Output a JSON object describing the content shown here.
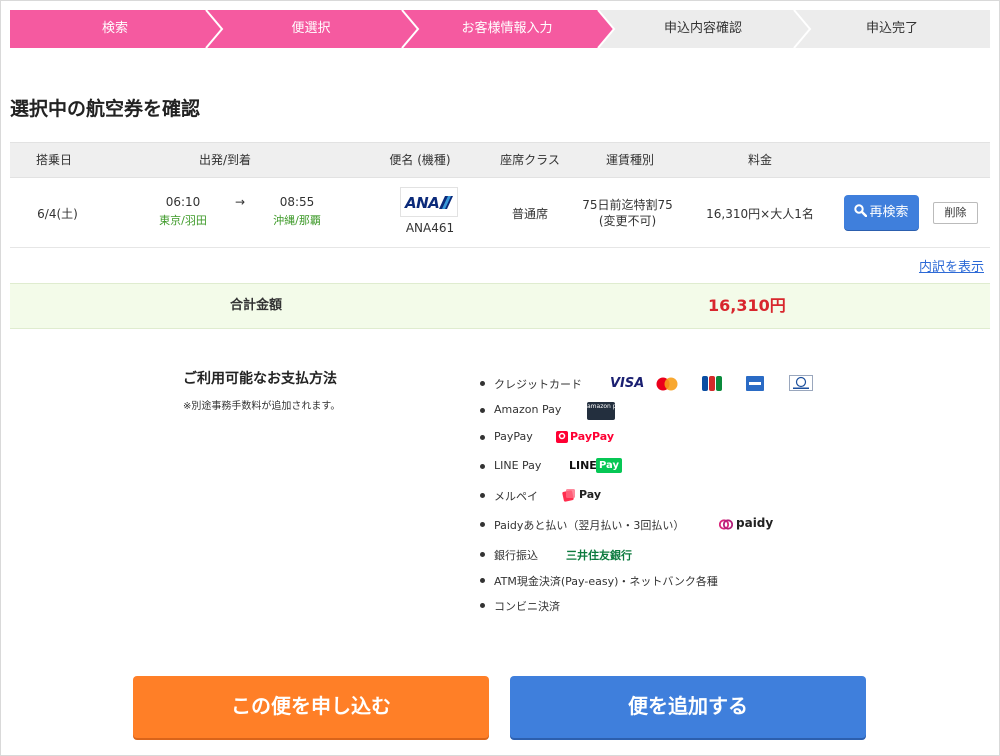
{
  "steps": [
    {
      "label": "検索",
      "active": true
    },
    {
      "label": "便選択",
      "active": true
    },
    {
      "label": "お客様情報入力",
      "active": true
    },
    {
      "label": "申込内容確認",
      "active": false
    },
    {
      "label": "申込完了",
      "active": false
    }
  ],
  "colors": {
    "step_active": "#f55aa0",
    "step_inactive": "#ececec",
    "accent_blue": "#3f7fdc",
    "accent_orange": "#ff7f27",
    "price_red": "#d8262d",
    "green": "#3e9a29"
  },
  "section_title": "選択中の航空券を確認",
  "table": {
    "headers": {
      "date": "搭乗日",
      "route": "出発/到着",
      "flight": "便名 (機種)",
      "seat": "座席クラス",
      "fare": "運賃種別",
      "price": "料金"
    },
    "row": {
      "date": "6/4(土)",
      "dep_time": "06:10",
      "dep_place": "東京/羽田",
      "arrow": "→",
      "arr_time": "08:55",
      "arr_place": "沖縄/那覇",
      "airline_logo": "ANA",
      "flight_no": "ANA461",
      "seat_class": "普通席",
      "fare_line1": "75日前迄特割75",
      "fare_line2": "(変更不可)",
      "price": "16,310円×大人1名",
      "research_label": "再検索",
      "research_icon": "search-icon",
      "delete_label": "削除"
    }
  },
  "detail_link": "内訳を表示",
  "total": {
    "label": "合計金額",
    "amount": "16,310円"
  },
  "payment": {
    "title": "ご利用可能なお支払方法",
    "note": "※別途事務手数料が追加されます。",
    "methods": [
      {
        "label": "クレジットカード",
        "logos": [
          "VISA",
          "mastercard",
          "JCB",
          "AMEX",
          "Diners Club"
        ]
      },
      {
        "label": "Amazon Pay",
        "logo_text": "amazon pay"
      },
      {
        "label": "PayPay",
        "logo_text": "PayPay"
      },
      {
        "label": "LINE Pay",
        "logo_line": "LINE",
        "logo_pay": "Pay"
      },
      {
        "label": "メルペイ",
        "logo_text": "Pay"
      },
      {
        "label": "Paidyあと払い（翌月払い・3回払い）",
        "logo_text": "paidy"
      },
      {
        "label": "銀行振込",
        "logo_text": "三井住友銀行"
      },
      {
        "label": "ATM現金決済(Pay-easy)・ネットバンク各種"
      },
      {
        "label": "コンビニ決済"
      }
    ]
  },
  "buttons": {
    "apply": "この便を申し込む",
    "add": "便を追加する"
  }
}
